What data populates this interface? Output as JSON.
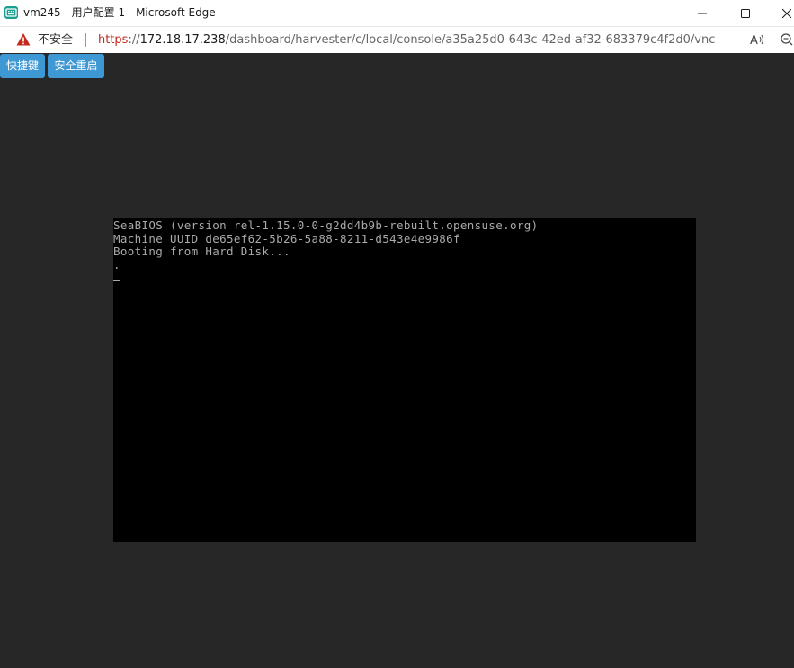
{
  "window": {
    "title": "vm245 - 用户配置 1 - Microsoft Edge",
    "app_icon": "vnc-console-icon",
    "controls": {
      "minimize_icon": "minimize-icon",
      "maximize_icon": "maximize-icon",
      "close_icon": "close-icon"
    }
  },
  "address_bar": {
    "security_icon": "warning-icon",
    "security_label": "不安全",
    "url_scheme": "https",
    "url_sep": "://",
    "url_host": "172.18.17.238",
    "url_path": "/dashboard/harvester/c/local/console/a35a25d0-643c-42ed-af32-683379c4f2d0/vnc",
    "read_aloud_icon": "read-aloud-icon",
    "zoom_icon": "zoom-icon"
  },
  "toolbar": {
    "shortcut_label": "快捷键",
    "reboot_label": "安全重启"
  },
  "console": {
    "lines": [
      "SeaBIOS (version rel-1.15.0-0-g2dd4b9b-rebuilt.opensuse.org)",
      "Machine UUID de65ef62-5b26-5a88-8211-d543e4e9986f",
      "Booting from Hard Disk...",
      "."
    ]
  },
  "colors": {
    "page_background": "#272727",
    "button_background": "#3d98d3",
    "console_background": "#000000",
    "console_text": "#aaaaaa",
    "warning": "#c42b1c"
  }
}
